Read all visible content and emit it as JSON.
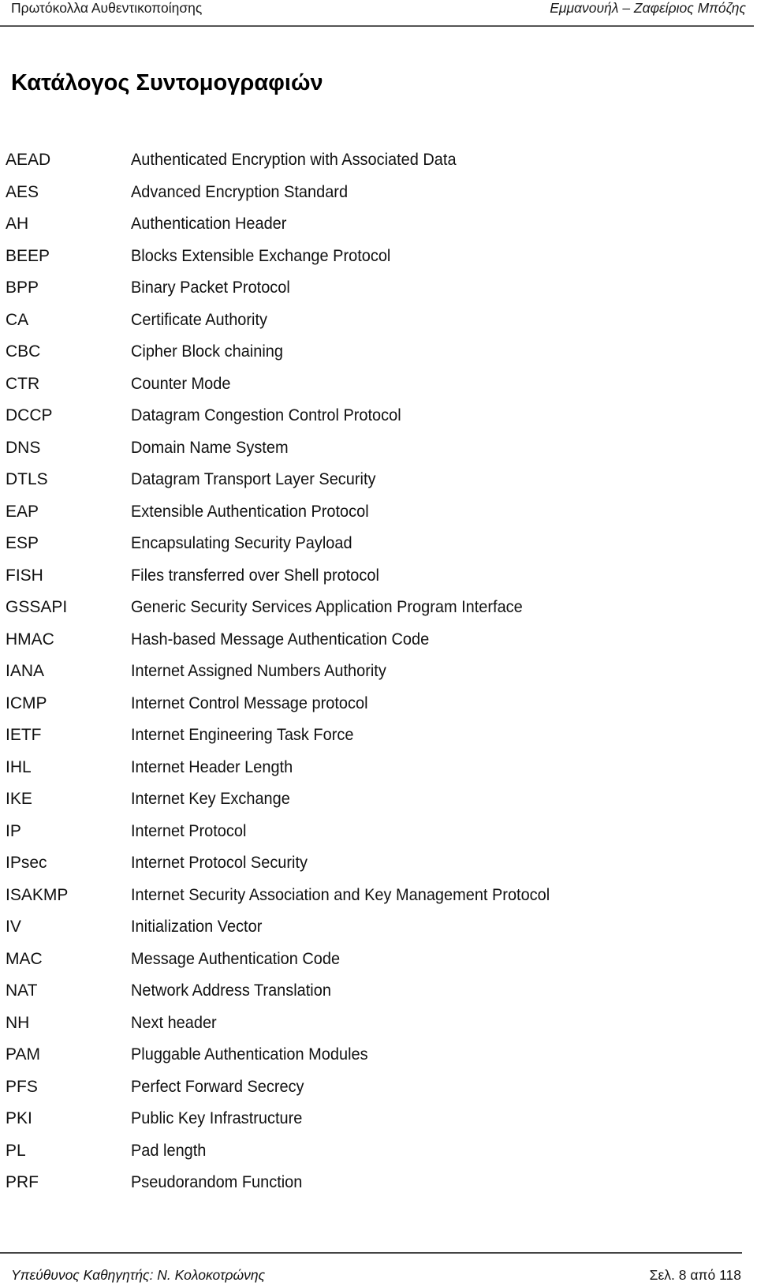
{
  "header": {
    "left_text": "Πρωτόκολλα Αυθεντικοποίησης",
    "right_text": "Εμμανουήλ – Ζαφείριος Μπόζης"
  },
  "title": "Κατάλογος Συντομογραφιών",
  "abbreviations": [
    {
      "term": "AEAD",
      "definition": "Authenticated Encryption with Associated Data"
    },
    {
      "term": "AES",
      "definition": "Advanced Encryption Standard"
    },
    {
      "term": "AH",
      "definition": "Authentication Header"
    },
    {
      "term": "BEEP",
      "definition": "Blocks Extensible Exchange Protocol"
    },
    {
      "term": "BPP",
      "definition": "Binary Packet Protocol"
    },
    {
      "term": "CA",
      "definition": "Certificate Authority"
    },
    {
      "term": "CBC",
      "definition": "Cipher Block chaining"
    },
    {
      "term": "CTR",
      "definition": "Counter Mode"
    },
    {
      "term": "DCCP",
      "definition": "Datagram Congestion Control Protocol"
    },
    {
      "term": "DNS",
      "definition": "Domain Name System"
    },
    {
      "term": "DTLS",
      "definition": "Datagram Transport Layer Security"
    },
    {
      "term": "EAP",
      "definition": "Extensible Authentication Protocol"
    },
    {
      "term": "ESP",
      "definition": "Encapsulating Security Payload"
    },
    {
      "term": "FISH",
      "definition": "Files transferred over Shell protocol"
    },
    {
      "term": "GSSAPI",
      "definition": "Generic Security Services Application Program Interface"
    },
    {
      "term": "HMAC",
      "definition": "Hash-based Message Authentication Code"
    },
    {
      "term": "IANA",
      "definition": "Internet Assigned Numbers Authority"
    },
    {
      "term": "ICMP",
      "definition": "Internet Control Message protocol"
    },
    {
      "term": "IETF",
      "definition": "Internet Engineering Task Force"
    },
    {
      "term": "IHL",
      "definition": "Internet Header Length"
    },
    {
      "term": "IKE",
      "definition": "Internet Key Exchange"
    },
    {
      "term": "IP",
      "definition": "Internet Protocol"
    },
    {
      "term": "IPsec",
      "definition": "Internet Protocol Security"
    },
    {
      "term": "ISAKMP",
      "definition": "Internet Security Association and Key Management Protocol"
    },
    {
      "term": "IV",
      "definition": "Initialization Vector"
    },
    {
      "term": "MAC",
      "definition": "Message Authentication Code"
    },
    {
      "term": "NAT",
      "definition": "Network Address Translation"
    },
    {
      "term": "NH",
      "definition": "Next header"
    },
    {
      "term": "PAM",
      "definition": "Pluggable Authentication Modules"
    },
    {
      "term": "PFS",
      "definition": "Perfect Forward Secrecy"
    },
    {
      "term": "PKI",
      "definition": "Public Key Infrastructure"
    },
    {
      "term": "PL",
      "definition": "Pad length"
    },
    {
      "term": "PRF",
      "definition": "Pseudorandom Function"
    }
  ],
  "footer": {
    "left_text": "Υπεύθυνος Καθηγητής: Ν. Κολοκοτρώνης",
    "right_text": "Σελ. 8 από 118"
  }
}
